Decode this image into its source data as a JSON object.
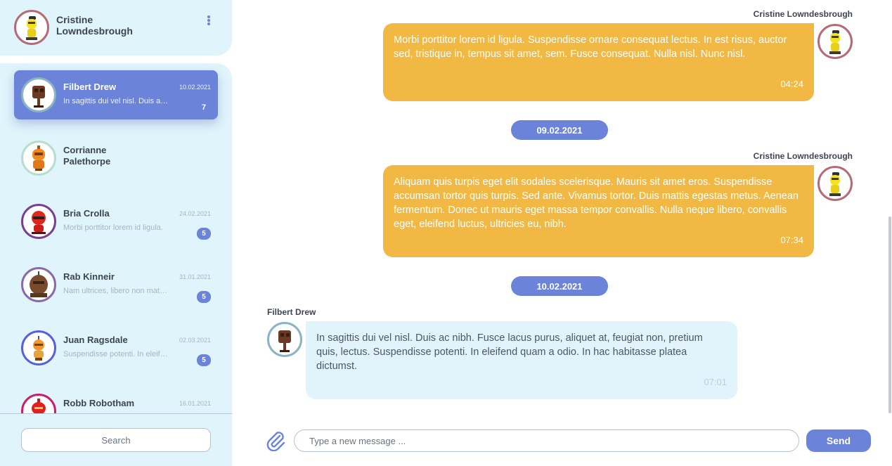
{
  "profile": {
    "name": "Cristine Lowndesbrough",
    "avatar_icon": "yellow-robot-avatar-icon",
    "menu_icon": "vertical-dots-menu-icon"
  },
  "contacts": [
    {
      "name": "Filbert Drew",
      "preview": "In sagittis dui vel nisl. Duis ac nibh.",
      "date": "10.02.2021",
      "unread": "7",
      "active": true,
      "avatar_icon": "brown-robot-avatar-icon",
      "ring_color": "#8bb4c2"
    },
    {
      "name": "Corrianne Palethorpe",
      "preview": "",
      "date": "",
      "unread": "",
      "active": false,
      "avatar_icon": "orange-robot-avatar-icon",
      "ring_color": "#b9dccb"
    },
    {
      "name": "Bria Crolla",
      "preview": "Morbi porttitor lorem id ligula.",
      "date": "24.02.2021",
      "unread": "5",
      "active": false,
      "avatar_icon": "red-robot-avatar-icon",
      "ring_color": "#7b3f8f"
    },
    {
      "name": "Rab Kinneir",
      "preview": "Nam ultrices, libero non mattis pulvinar.",
      "date": "31.01.2021",
      "unread": "5",
      "active": false,
      "avatar_icon": "brown-robot-avatar-icon",
      "ring_color": "#8a6aa6"
    },
    {
      "name": "Juan Ragsdale",
      "preview": "Suspendisse potenti. In eleifend quam.",
      "date": "02.03.2021",
      "unread": "5",
      "active": false,
      "avatar_icon": "orange-robot-avatar-icon",
      "ring_color": "#5560e0"
    },
    {
      "name": "Robb Robotham",
      "preview": "",
      "date": "16.01.2021",
      "unread": "",
      "active": false,
      "avatar_icon": "red-robot-avatar-icon",
      "ring_color": "#c81f6a"
    }
  ],
  "search": {
    "placeholder": "Search"
  },
  "chat": {
    "messages": [
      {
        "sender": "Cristine Lowndesbrough",
        "direction": "out",
        "text": "Morbi porttitor lorem id ligula. Suspendisse ornare consequat lectus. In est risus, auctor sed, tristique in, tempus sit amet, sem. Fusce consequat. Nulla nisl. Nunc nisl.",
        "time": "04:24"
      },
      {
        "date_divider": "09.02.2021"
      },
      {
        "sender": "Cristine Lowndesbrough",
        "direction": "out",
        "text": "Aliquam quis turpis eget elit sodales scelerisque. Mauris sit amet eros. Suspendisse accumsan tortor quis turpis. Sed ante. Vivamus tortor. Duis mattis egestas metus. Aenean fermentum. Donec ut mauris eget massa tempor convallis. Nulla neque libero, convallis eget, eleifend luctus, ultricies eu, nibh.",
        "time": "07:34"
      },
      {
        "date_divider": "10.02.2021"
      },
      {
        "sender": "Filbert Drew",
        "direction": "in",
        "text": "In sagittis dui vel nisl. Duis ac nibh. Fusce lacus purus, aliquet at, feugiat non, pretium quis, lectus. Suspendisse potenti. In eleifend quam a odio. In hac habitasse platea dictumst.",
        "time": "07:01"
      }
    ]
  },
  "composer": {
    "attach_icon": "paperclip-icon",
    "placeholder": "Type a new message ...",
    "send_label": "Send"
  },
  "colors": {
    "accent": "#6b83d9",
    "outgoing_bubble": "#f2b844",
    "incoming_bubble": "#e1f4fb",
    "sidebar_bg": "#e0f4fb"
  }
}
